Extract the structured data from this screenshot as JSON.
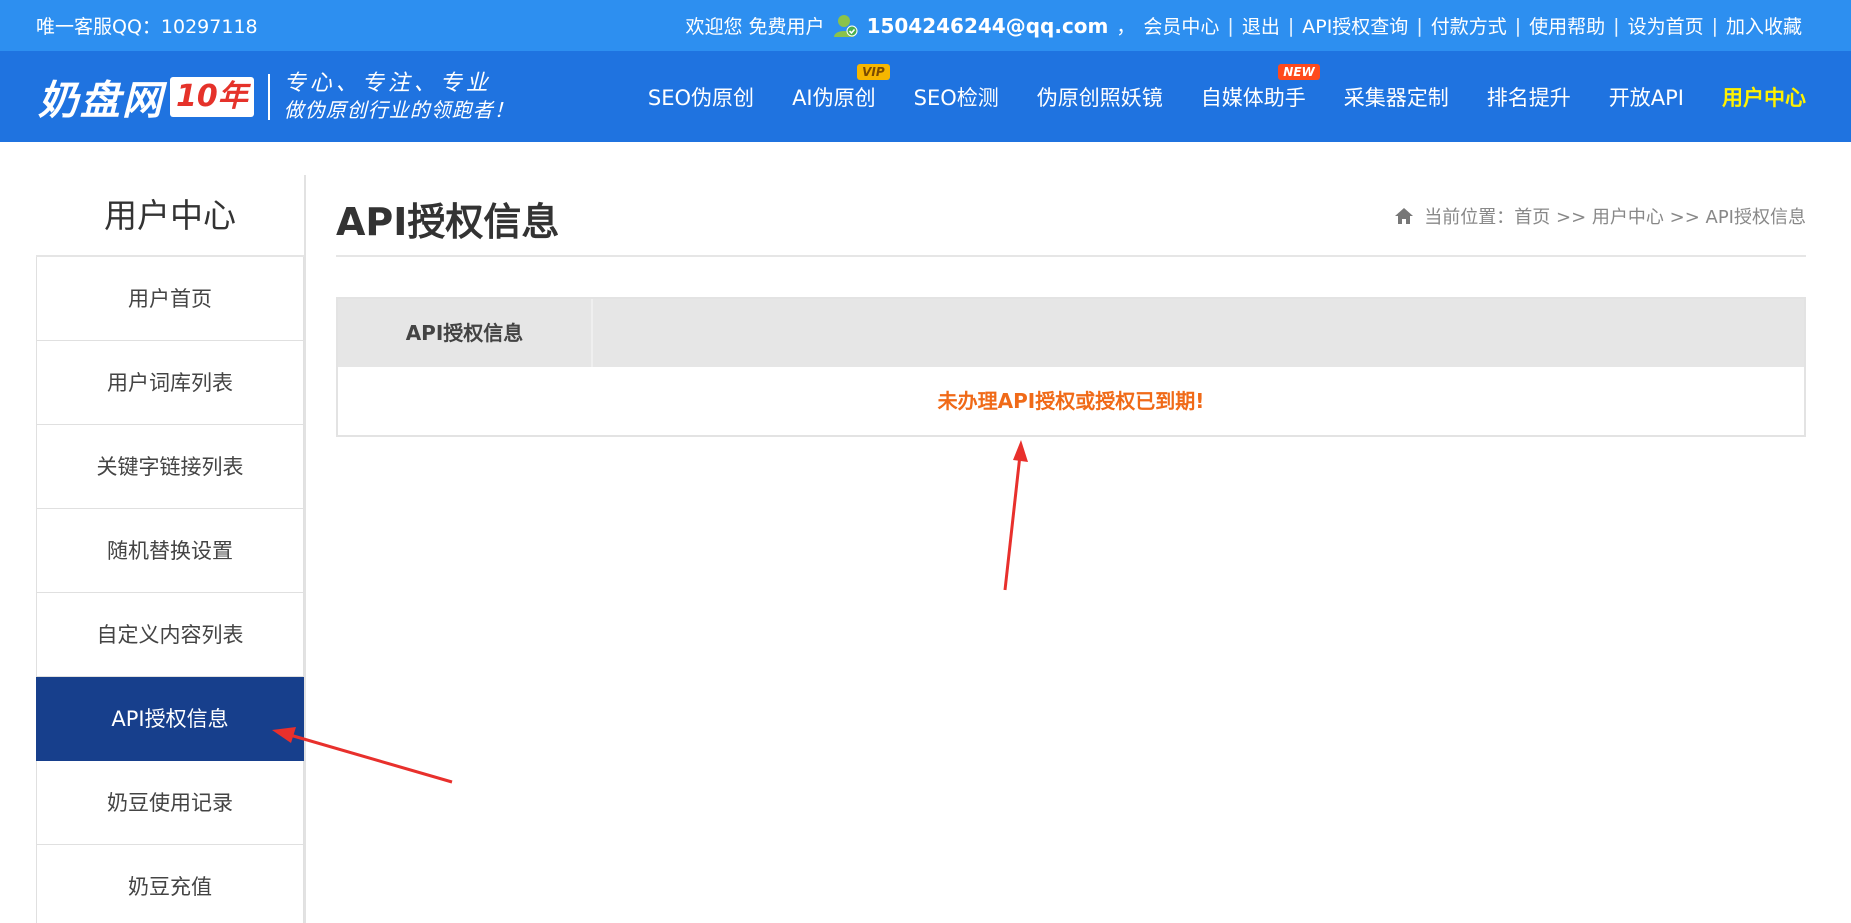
{
  "topbar": {
    "qq": "唯一客服QQ：10297118",
    "welcome": "欢迎您 免费用户",
    "email": "1504246244@qq.com",
    "comma": "，",
    "links": [
      "会员中心",
      "退出",
      "API授权查询",
      "付款方式",
      "使用帮助",
      "设为首页",
      "加入收藏"
    ]
  },
  "logo": {
    "brand": "奶盘网",
    "badge": "10年",
    "slogan_line1": "专心、专注、专业",
    "slogan_line2": "做伪原创行业的领跑者！"
  },
  "nav": {
    "items": [
      "SEO伪原创",
      "AI伪原创",
      "SEO检测",
      "伪原创照妖镜",
      "自媒体助手",
      "采集器定制",
      "排名提升",
      "开放API",
      "用户中心"
    ],
    "vip_badge": "VIP",
    "new_badge": "NEW"
  },
  "sidebar": {
    "title": "用户中心",
    "items": [
      "用户首页",
      "用户词库列表",
      "关键字链接列表",
      "随机替换设置",
      "自定义内容列表",
      "API授权信息",
      "奶豆使用记录",
      "奶豆充值"
    ]
  },
  "main": {
    "title": "API授权信息",
    "breadcrumb": "当前位置：首页 >> 用户中心 >> API授权信息",
    "table": {
      "header": "API授权信息",
      "message": "未办理API授权或授权已到期!"
    }
  },
  "colors": {
    "topbar": "#2d8ff0",
    "header": "#1f73e0",
    "active_nav": "#fff200",
    "sidebar_active": "#173f8c",
    "message": "#f06a18",
    "arrow": "#e8302c"
  }
}
